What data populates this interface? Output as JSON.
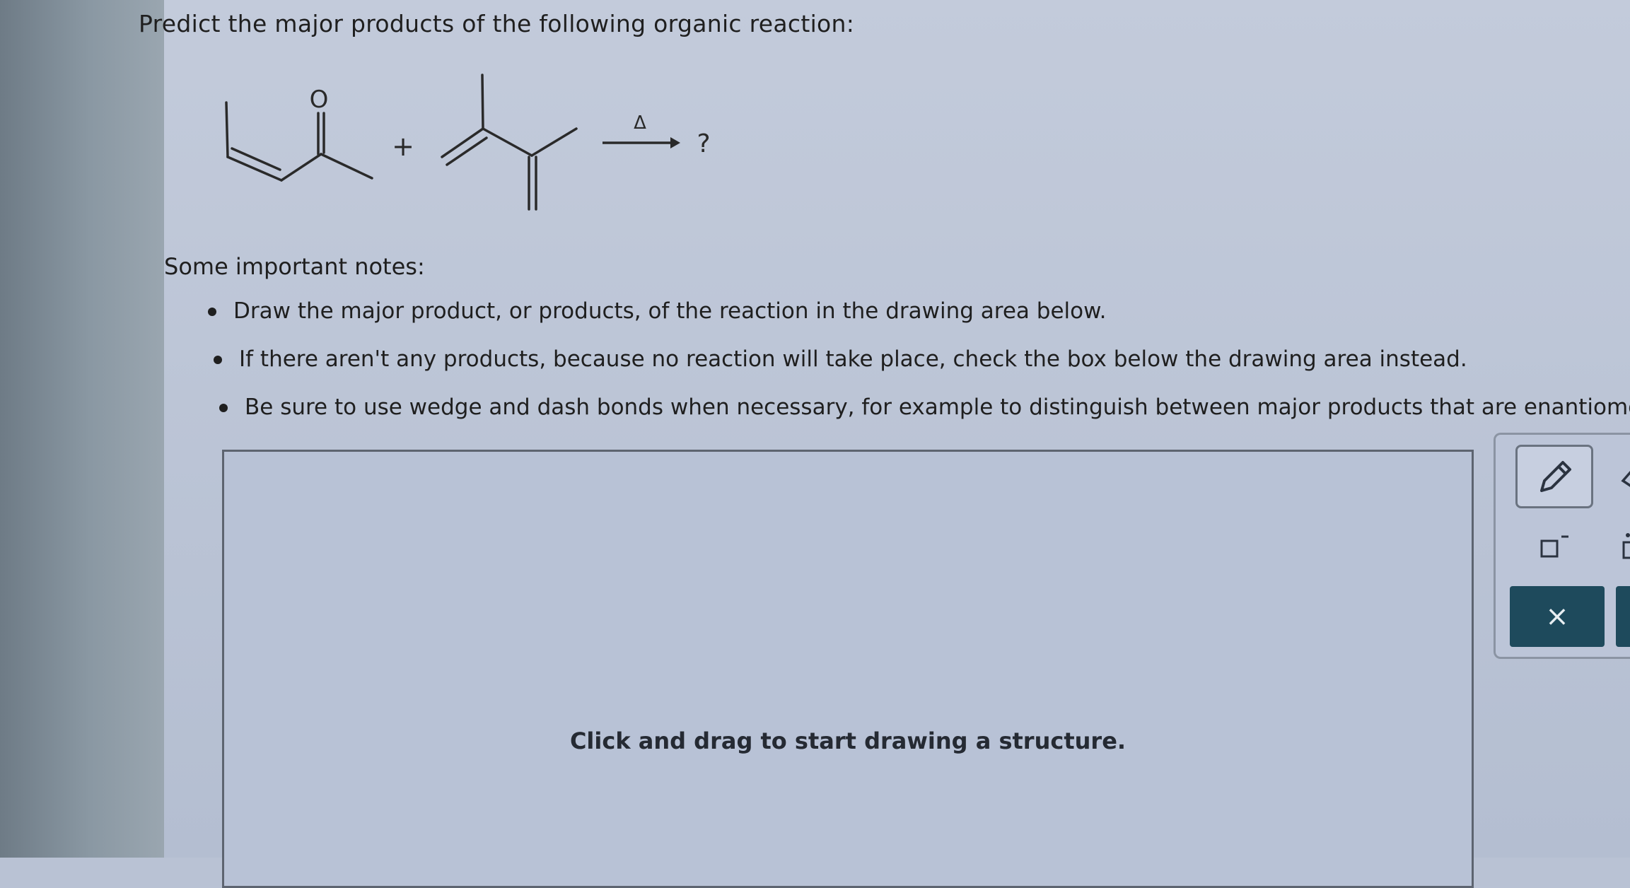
{
  "question": {
    "title": "Predict the major products of the following organic reaction:"
  },
  "reaction": {
    "oxygen_label": "O",
    "plus": "+",
    "condition": "Δ",
    "product": "?"
  },
  "notes": {
    "heading": "Some important notes:",
    "items": [
      "Draw the major product, or products, of the reaction in the drawing area below.",
      "If there aren't any products, because no reaction will take place, check the box below the drawing area instead.",
      "Be sure to use wedge and dash bonds when necessary, for example to distinguish between major products that are enantiomers."
    ]
  },
  "drawing_area": {
    "hint": "Click and drag to start drawing a structure."
  },
  "toolbar": {
    "tools": [
      "pencil-icon",
      "eraser-icon",
      "charge-icon",
      "lone-pair-icon",
      "close-icon"
    ],
    "clear_symbol": "×"
  },
  "colors": {
    "clear_button": "#1e4a5c",
    "screen_background": "#b9c2d4"
  }
}
